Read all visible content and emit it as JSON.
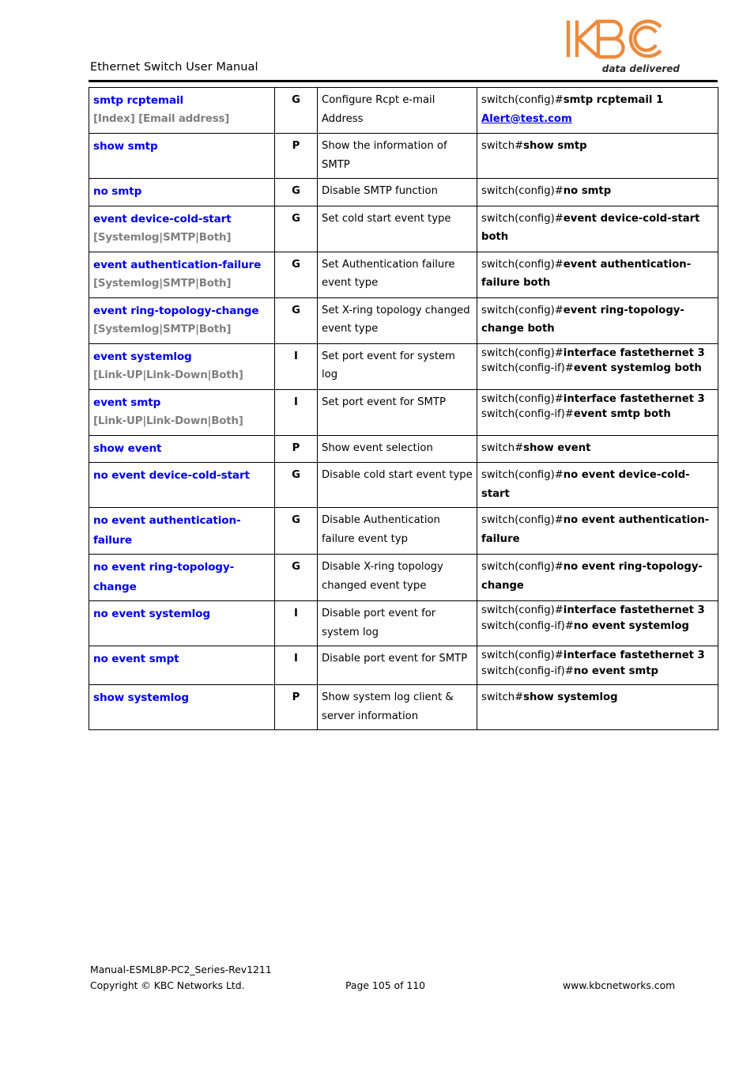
{
  "header": {
    "title": "Ethernet Switch User Manual",
    "logo_text": "KBC",
    "logo_tagline": "data delivered",
    "logo_color": "#ED8B3C"
  },
  "table": {
    "rows": [
      {
        "command": "smtp rcptemail",
        "params": "[Index] [Email address]",
        "mode": "G",
        "description": "Configure Rcpt e-mail Address",
        "example_prefix": "switch(config)#",
        "example_bold": "smtp rcptemail 1",
        "example_link": "Alert@test.com"
      },
      {
        "command": "show smtp",
        "params": "",
        "mode": "P",
        "description": "Show the information of SMTP",
        "example_prefix": "switch#",
        "example_bold": "show smtp"
      },
      {
        "command": "no smtp",
        "params": "",
        "mode": "G",
        "description": "Disable SMTP function",
        "example_prefix": "switch(config)#",
        "example_bold": "no smtp"
      },
      {
        "command": "event device-cold-start",
        "params": "[Systemlog|SMTP|Both]",
        "mode": "G",
        "description": "Set cold start event type",
        "example_prefix": "switch(config)#",
        "example_bold": "event device-cold-start both"
      },
      {
        "command": "event authentication-failure",
        "params": "[Systemlog|SMTP|Both]",
        "mode": "G",
        "description": "Set Authentication failure event type",
        "example_prefix": "switch(config)#",
        "example_bold": "event authentication-failure both"
      },
      {
        "command": "event ring-topology-change",
        "params": "[Systemlog|SMTP|Both]",
        "mode": "G",
        "description": "Set X-ring topology changed event type",
        "example_prefix": "switch(config)#",
        "example_bold": "event ring-topology-change both"
      },
      {
        "command": "event systemlog",
        "params": "[Link-UP|Link-Down|Both]",
        "mode": "I",
        "description": "Set port event for system log",
        "example_prefix": "switch(config)#",
        "example_bold": "interface fastethernet 3",
        "example_prefix2": "switch(config-if)#",
        "example_bold2": "event systemlog both"
      },
      {
        "command": "event smtp",
        "params": "[Link-UP|Link-Down|Both]",
        "mode": "I",
        "description": "Set port event for SMTP",
        "example_prefix": "switch(config)#",
        "example_bold": "interface fastethernet 3",
        "example_prefix2": "switch(config-if)#",
        "example_bold2": "event smtp both"
      },
      {
        "command": "show event",
        "params": "",
        "mode": "P",
        "description": "Show event selection",
        "example_prefix": "switch#",
        "example_bold": "show event"
      },
      {
        "command": "no event device-cold-start",
        "params": "",
        "mode": "G",
        "description": "Disable cold start event type",
        "example_prefix": "switch(config)#",
        "example_bold": "no event device-cold-start"
      },
      {
        "command": "no event authentication-failure",
        "params": "",
        "mode": "G",
        "description": "Disable Authentication failure event typ",
        "example_prefix": "switch(config)#",
        "example_bold": "no event authentication-failure"
      },
      {
        "command": "no event ring-topology-change",
        "params": "",
        "mode": "G",
        "description": "Disable X-ring topology changed event type",
        "example_prefix": "switch(config)#",
        "example_bold": "no event ring-topology-change"
      },
      {
        "command": "no event systemlog",
        "params": "",
        "mode": "I",
        "description": "Disable port event for system log",
        "example_prefix": "switch(config)#",
        "example_bold": "interface fastethernet 3",
        "example_prefix2": "switch(config-if)#",
        "example_bold2": "no event systemlog"
      },
      {
        "command": "no event smpt",
        "params": "",
        "mode": "I",
        "description": "Disable port event for SMTP",
        "example_prefix": "switch(config)#",
        "example_bold": "interface fastethernet 3",
        "example_prefix2": "switch(config-if)#",
        "example_bold2": "no event smtp"
      },
      {
        "command": "show systemlog",
        "params": "",
        "mode": "P",
        "description": "Show system log client & server information",
        "example_prefix": "switch#",
        "example_bold": "show systemlog"
      }
    ]
  },
  "footer": {
    "manual_id": "Manual-ESML8P-PC2_Series-Rev1211",
    "copyright": "Copyright © KBC Networks Ltd.",
    "page": "Page 105 of 110",
    "website": "www.kbcnetworks.com"
  }
}
